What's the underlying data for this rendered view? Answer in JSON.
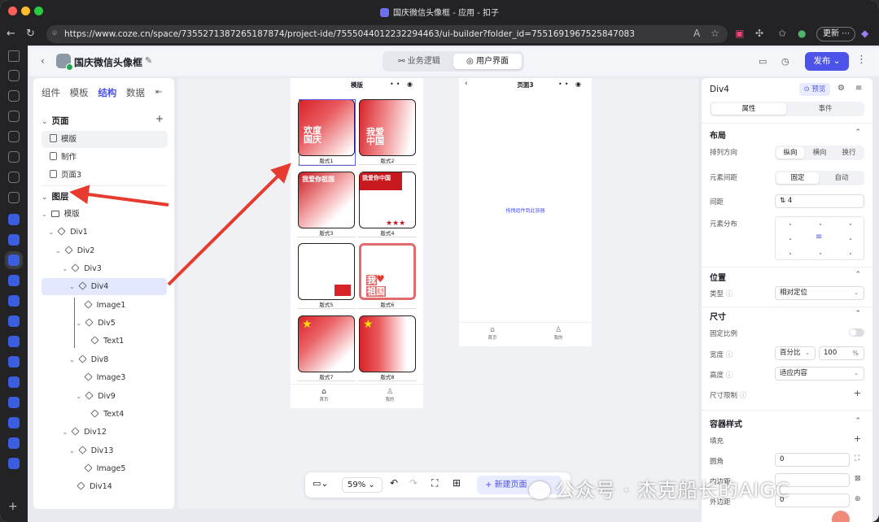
{
  "browser": {
    "window_title": "国庆微信头像框 - 应用 - 扣子",
    "url": "https://www.coze.cn/space/7355271387265187874/project-ide/7555044012232294463/ui-builder?folder_id=7551691967525847083",
    "update_label": "更新"
  },
  "header": {
    "project_name": "国庆微信头像框",
    "modes": [
      "业务逻辑",
      "用户界面"
    ],
    "publish_label": "发布"
  },
  "left_panel": {
    "tabs": [
      "组件",
      "模板",
      "结构",
      "数据"
    ],
    "pages_title": "页面",
    "pages": [
      "模版",
      "制作",
      "页面3"
    ],
    "layers_title": "图层",
    "layers": [
      {
        "label": "模版",
        "depth": 0
      },
      {
        "label": "Div1",
        "depth": 1
      },
      {
        "label": "Div2",
        "depth": 2
      },
      {
        "label": "Div3",
        "depth": 3
      },
      {
        "label": "Div4",
        "depth": 4
      },
      {
        "label": "Image1",
        "depth": 5
      },
      {
        "label": "Div5",
        "depth": 5
      },
      {
        "label": "Text1",
        "depth": 6
      },
      {
        "label": "Div8",
        "depth": 4
      },
      {
        "label": "Image3",
        "depth": 5
      },
      {
        "label": "Div9",
        "depth": 5
      },
      {
        "label": "Text4",
        "depth": 6
      },
      {
        "label": "Div12",
        "depth": 3
      },
      {
        "label": "Div13",
        "depth": 4
      },
      {
        "label": "Image5",
        "depth": 5
      },
      {
        "label": "Div14",
        "depth": 4
      }
    ]
  },
  "canvas": {
    "phone1_title": "模版",
    "cards": [
      "版式1",
      "版式2",
      "版式3",
      "版式4",
      "版式5",
      "版式6",
      "版式7",
      "版式8"
    ],
    "card_texts": {
      "c1": "欢度国庆",
      "c2": "我爱中国",
      "c3": "我爱你祖国",
      "c4": "我爱你中国",
      "c6a": "我",
      "c6b": "祖国"
    },
    "phone1_tabs": [
      "首页",
      "我的"
    ],
    "phone2_title": "页面3",
    "drop_hint": "拖拽组件到此容器",
    "phone2_tabs": [
      "首页",
      "我的"
    ],
    "zoom": "59%",
    "new_page_label": "新建页面"
  },
  "right_panel": {
    "component_name": "Div4",
    "preview_label": "预览",
    "tabs": [
      "属性",
      "事件"
    ],
    "layout": {
      "title": "布局",
      "direction_label": "排列方向",
      "direction_options": [
        "纵向",
        "横向",
        "换行"
      ],
      "spacing_label": "元素间距",
      "spacing_options": [
        "固定",
        "自动"
      ],
      "gap_label": "间距",
      "gap_value": "4",
      "distribution_label": "元素分布"
    },
    "position": {
      "title": "位置",
      "type_label": "类型",
      "type_value": "相对定位"
    },
    "size": {
      "title": "尺寸",
      "fixed_ratio_label": "固定比例",
      "width_label": "宽度",
      "width_unit": "百分比",
      "width_value": "100",
      "width_suffix": "%",
      "height_label": "高度",
      "height_value": "适应内容",
      "limit_label": "尺寸限制"
    },
    "container_style": {
      "title": "容器样式",
      "fill_label": "填充",
      "radius_label": "圆角",
      "radius_value": "0",
      "padding_label": "内边距",
      "margin_label": "外边距",
      "margin_value": "0"
    }
  },
  "watermark": "公众号 · 杰克船长的AIGC",
  "colors": {
    "accent": "#4d53e8",
    "arrow": "#e63b2e",
    "festive_red": "#d8232a"
  }
}
